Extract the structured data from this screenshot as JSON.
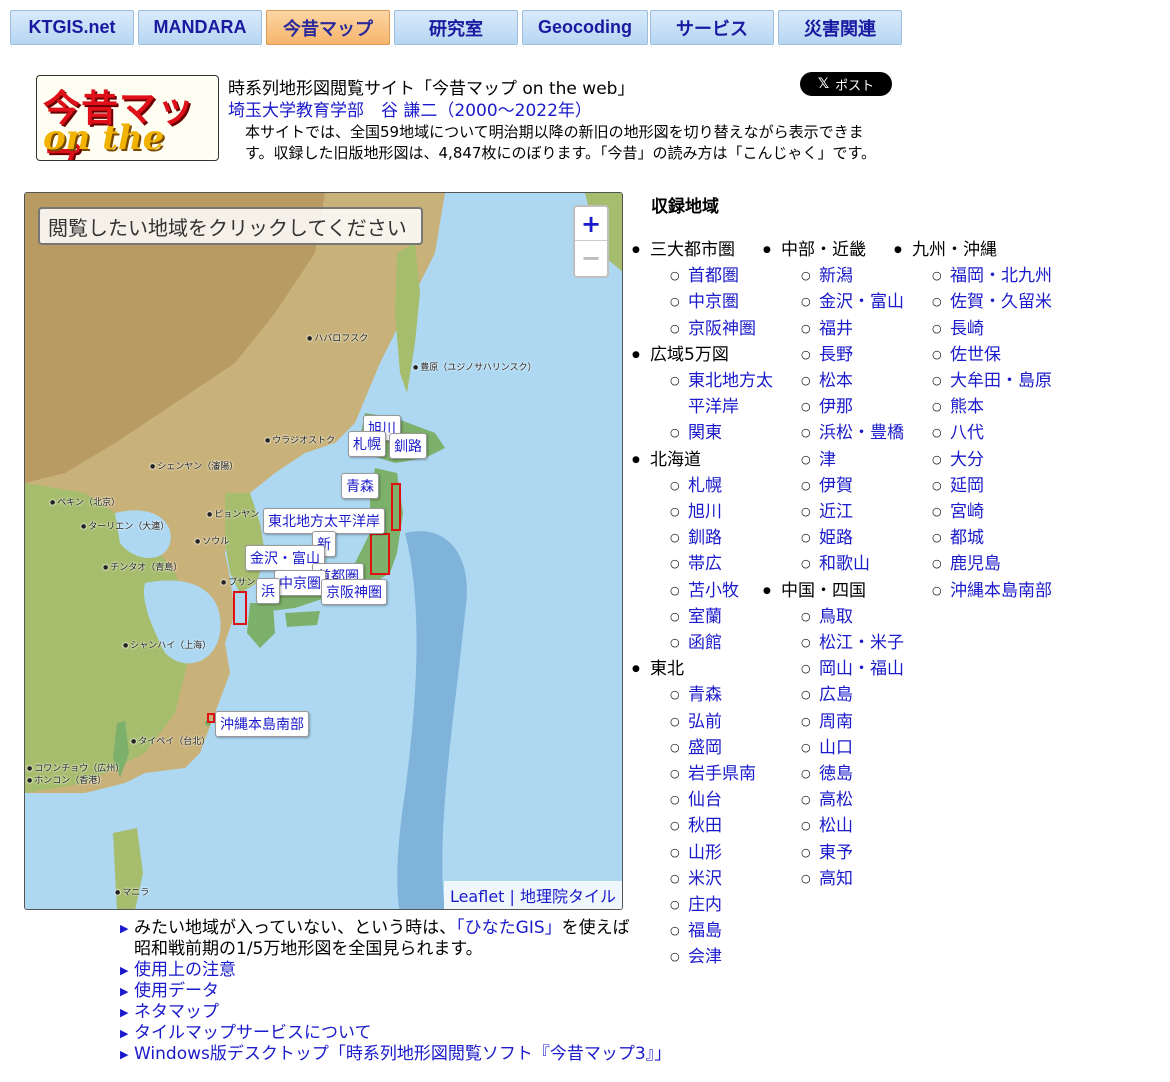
{
  "tabs": [
    {
      "label": "KTGIS.net",
      "active": false
    },
    {
      "label": "MANDARA",
      "active": false
    },
    {
      "label": "今昔マップ",
      "active": true
    },
    {
      "label": "研究室",
      "active": false
    },
    {
      "label": "Geocoding",
      "active": false
    },
    {
      "label": "サービス",
      "active": false
    },
    {
      "label": "災害関連",
      "active": false
    }
  ],
  "logo": {
    "line1": "今昔マップ",
    "line2": "on the web"
  },
  "header": {
    "title": "時系列地形図閲覧サイト「今昔マップ on the web」",
    "author": "埼玉大学教育学部　谷 謙二（2000〜2022年）",
    "intro": "本サイトでは、全国59地域について明治期以降の新旧の地形図を切り替えながら表示できます。収録した旧版地形図は、4,847枚にのぼります。「今昔」の読み方は「こんじゃく」です。",
    "post_button": "ポスト"
  },
  "map": {
    "instruction": "閲覧したい地域をクリックしてください",
    "zoom_in": "+",
    "zoom_out": "−",
    "attribution": "Leaflet | 地理院タイル",
    "places": [
      {
        "name": "ハバロフスク"
      },
      {
        "name": "豊原（ユジノサハリンスク）"
      },
      {
        "name": "ウラジオストク"
      },
      {
        "name": "シェンヤン（瀋陽）"
      },
      {
        "name": "ペキン（北京）"
      },
      {
        "name": "ピョンヤン（平壌）"
      },
      {
        "name": "ターリエン（大連）"
      },
      {
        "name": "ソウル"
      },
      {
        "name": "チンタオ（青島）"
      },
      {
        "name": "ブサン"
      },
      {
        "name": "シャンハイ（上海）"
      },
      {
        "name": "タイペイ（台北）"
      },
      {
        "name": "コワンチョウ（広州）"
      },
      {
        "name": "ホンコン（香港）"
      },
      {
        "name": "マニラ"
      }
    ],
    "labels": [
      {
        "text": "旭川"
      },
      {
        "text": "札幌"
      },
      {
        "text": "釧路"
      },
      {
        "text": "青森"
      },
      {
        "text": "東北地方太平洋岸"
      },
      {
        "text": "新"
      },
      {
        "text": "金沢・富山"
      },
      {
        "text": "首都圏"
      },
      {
        "text": "中京圏"
      },
      {
        "text": "京阪神圏"
      },
      {
        "text": "浜"
      },
      {
        "text": "沖縄本島南部"
      }
    ]
  },
  "regions": {
    "heading": "収録地域",
    "columns": [
      [
        {
          "category": "三大都市圏",
          "items": [
            "首都圏",
            "中京圏",
            "京阪神圏"
          ]
        },
        {
          "category": "広域5万図",
          "items": [
            "東北地方太平洋岸",
            "関東"
          ]
        },
        {
          "category": "北海道",
          "items": [
            "札幌",
            "旭川",
            "釧路",
            "帯広",
            "苫小牧",
            "室蘭",
            "函館"
          ]
        },
        {
          "category": "東北",
          "items": [
            "青森",
            "弘前",
            "盛岡",
            "岩手県南",
            "仙台",
            "秋田",
            "山形",
            "米沢",
            "庄内",
            "福島",
            "会津"
          ]
        }
      ],
      [
        {
          "category": "中部・近畿",
          "items": [
            "新潟",
            "金沢・富山",
            "福井",
            "長野",
            "松本",
            "伊那",
            "浜松・豊橋",
            "津",
            "伊賀",
            "近江",
            "姫路",
            "和歌山"
          ]
        },
        {
          "category": "中国・四国",
          "items": [
            "鳥取",
            "松江・米子",
            "岡山・福山",
            "広島",
            "周南",
            "山口",
            "徳島",
            "高松",
            "松山",
            "東予",
            "高知"
          ]
        }
      ],
      [
        {
          "category": "九州・沖縄",
          "items": [
            "福岡・北九州",
            "佐賀・久留米",
            "長崎",
            "佐世保",
            "大牟田・島原",
            "熊本",
            "八代",
            "大分",
            "延岡",
            "宮崎",
            "都城",
            "鹿児島",
            "沖縄本島南部"
          ]
        }
      ]
    ]
  },
  "bottom": {
    "hinata_pre": "みたい地域が入っていない、という時は、",
    "hinata_link": "「ひなたGIS」",
    "hinata_post": "を使えば",
    "hinata_line2": "昭和戦前期の1/5万地形図を全国見られます。",
    "links": [
      "使用上の注意",
      "使用データ",
      "ネタマップ",
      "タイルマップサービスについて",
      "Windows版デスクトップ「時系列地形図閲覧ソフト『今昔マップ3』」"
    ]
  }
}
